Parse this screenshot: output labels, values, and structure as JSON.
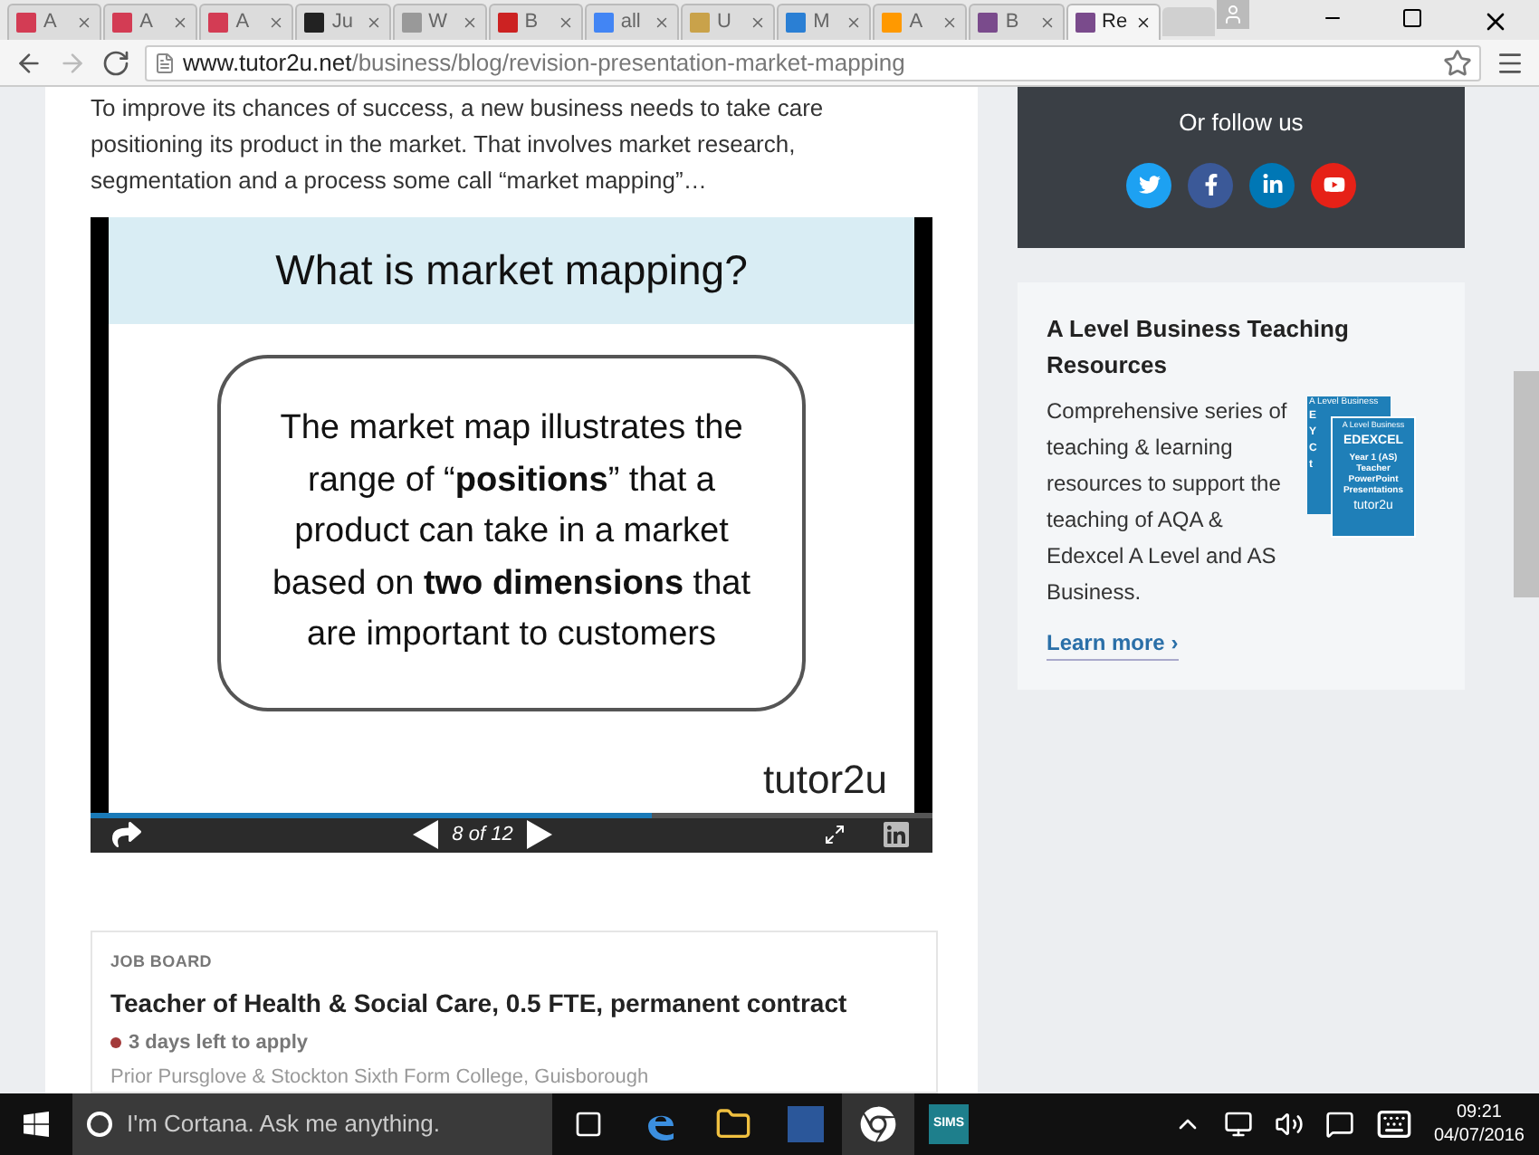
{
  "browser": {
    "tabs": [
      {
        "title": "A",
        "selected": false
      },
      {
        "title": "A",
        "selected": false
      },
      {
        "title": "A",
        "selected": false
      },
      {
        "title": "Ju",
        "selected": false
      },
      {
        "title": "W",
        "selected": false
      },
      {
        "title": "B",
        "selected": false
      },
      {
        "title": "all",
        "selected": false
      },
      {
        "title": "U",
        "selected": false
      },
      {
        "title": "M",
        "selected": false
      },
      {
        "title": "A",
        "selected": false
      },
      {
        "title": "B",
        "selected": false
      },
      {
        "title": "Re",
        "selected": true
      }
    ],
    "url_host": "www.tutor2u.net",
    "url_path": "/business/blog/revision-presentation-market-mapping"
  },
  "article": {
    "intro": "To improve its chances of success, a new business needs to take care positioning its product in the market.  That involves market research, segmentation and a process some call “market mapping”…",
    "slide": {
      "title": "What is market mapping?",
      "body": "The market map illustrates the range of “**positions**” that a product can take in a market based on **two dimensions** that are important to customers",
      "logo": "tutor2u",
      "level": 0.667,
      "counter": "8 of 12"
    }
  },
  "job_board": {
    "label": "JOB BOARD",
    "title": "Teacher of Health & Social Care, 0.5 FTE, permanent contract",
    "deadline": "3 days left to apply",
    "color": "#a33a3a",
    "school": "Prior Pursglove & Stockton Sixth Form College, Guisborough"
  },
  "follow": {
    "heading": "Or follow us"
  },
  "promo": {
    "title": "A Level Business Teaching Resources",
    "text": "Comprehensive series of teaching & learning resources to support the teaching of AQA & Edexcel A Level and AS Business.",
    "link": "Learn more ›",
    "cover_back": [
      "A Level Business",
      "E",
      "Y",
      "C",
      "t"
    ],
    "cover_front": [
      "A Level Business",
      "EDEXCEL",
      "Year 1 (AS) Teacher PowerPoint Presentations",
      "tutor2u"
    ]
  },
  "taskbar": {
    "search_placeholder": "I'm Cortana. Ask me anything.",
    "app_label": "SIMS",
    "time": "09:21",
    "date": "04/07/2016"
  }
}
